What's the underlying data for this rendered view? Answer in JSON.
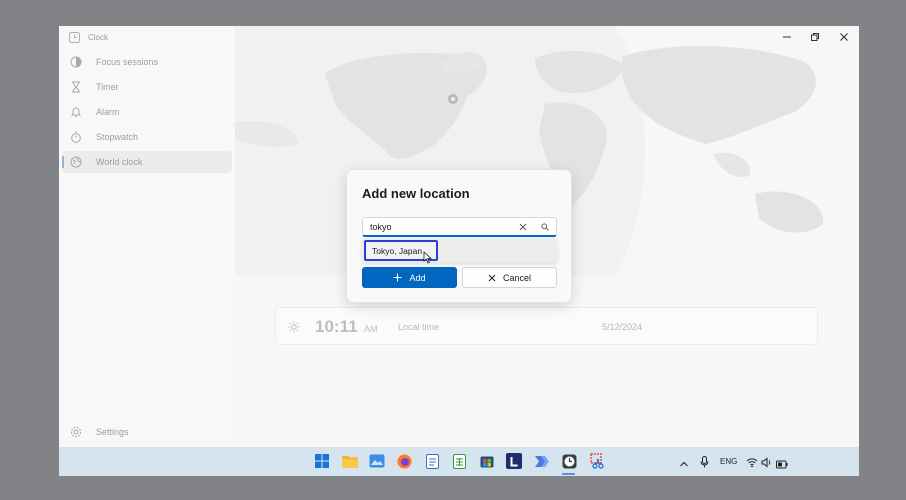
{
  "app": {
    "title": "Clock"
  },
  "nav": {
    "items": [
      {
        "label": "Focus sessions",
        "icon": "focus-icon"
      },
      {
        "label": "Timer",
        "icon": "hourglass-icon"
      },
      {
        "label": "Alarm",
        "icon": "bell-icon"
      },
      {
        "label": "Stopwatch",
        "icon": "stopwatch-icon"
      },
      {
        "label": "World clock",
        "icon": "globe-icon",
        "selected": true
      }
    ],
    "settings_label": "Settings"
  },
  "world_clock": {
    "time": "10:11",
    "ampm": "AM",
    "label": "Local time",
    "date": "5/12/2024"
  },
  "dialog": {
    "title": "Add new location",
    "search_value": "tokyo",
    "suggestion": "Tokyo, Japan",
    "add_label": "Add",
    "cancel_label": "Cancel"
  },
  "taskbar": {
    "language": "ENG"
  },
  "colors": {
    "accent": "#0067c0",
    "highlight_border": "#2b3fd1",
    "taskbar": "#d6e4ef"
  }
}
